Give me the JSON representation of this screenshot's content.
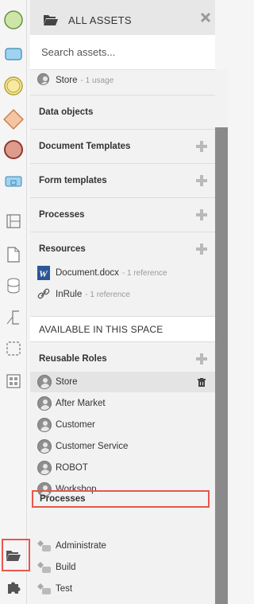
{
  "panel": {
    "title": "ALL ASSETS",
    "search_placeholder": "Search assets...",
    "top_item": {
      "label": "Store",
      "meta": "- 1 usage"
    },
    "sections": {
      "data_objects": "Data objects",
      "document_templates": "Document Templates",
      "form_templates": "Form templates",
      "processes": "Processes",
      "resources": "Resources"
    },
    "resources": [
      {
        "label": "Document.docx",
        "meta": "- 1 reference",
        "icon": "word-doc-icon"
      },
      {
        "label": "InRule",
        "meta": "- 1 reference",
        "icon": "link-icon"
      }
    ],
    "available_title": "AVAILABLE IN THIS SPACE",
    "reusable_roles_title": "Reusable Roles",
    "roles": [
      "Store",
      "After Market",
      "Customer",
      "Customer Service",
      "ROBOT",
      "Workshop"
    ],
    "space_processes_title": "Processes",
    "space_processes": [
      "Administrate",
      "Build",
      "Test"
    ]
  },
  "colors": {
    "start_event": "#cde6a8",
    "task": "#9fd4f0",
    "intermediate_event": "#f8e9a1",
    "gateway": "#f6c3a3",
    "end_event": "#dd9b8c",
    "highlight": "#e8574d"
  }
}
